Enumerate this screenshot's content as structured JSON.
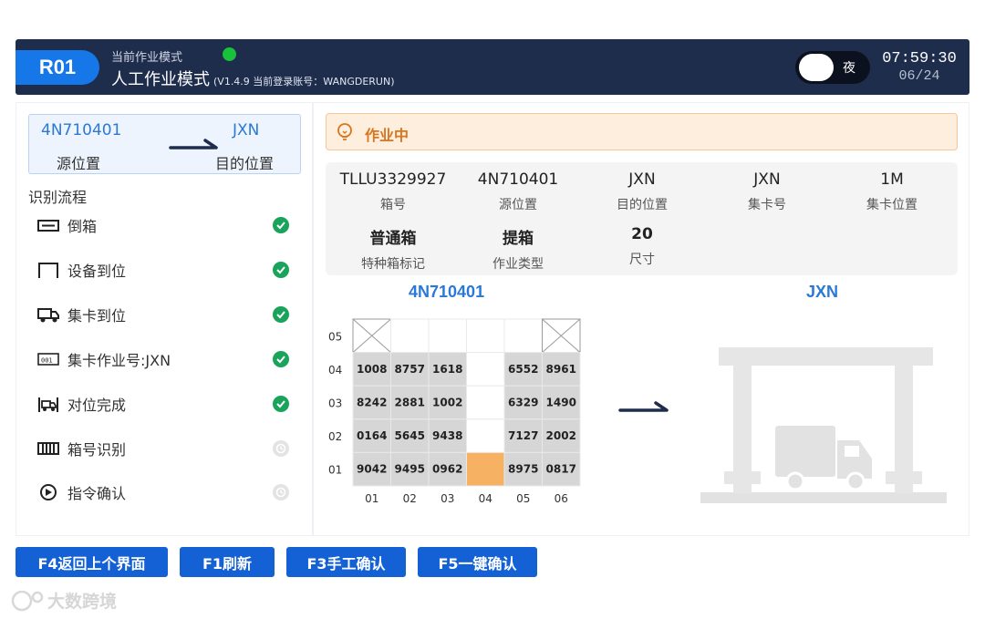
{
  "header": {
    "badge": "R01",
    "mode_caption": "当前作业模式",
    "mode_title": "人工作业模式",
    "version_info": "(V1.4.9 当前登录账号：WANGDERUN)",
    "night_toggle_label": "夜",
    "time": "07:59:30",
    "date": "06/24",
    "status_color": "#18c23a"
  },
  "route": {
    "source_code": "4N710401",
    "source_label": "源位置",
    "dest_code": "JXN",
    "dest_label": "目的位置"
  },
  "flow": {
    "title": "识别流程",
    "steps": [
      {
        "label": "倒箱",
        "icon": "container-icon",
        "status": "done"
      },
      {
        "label": "设备到位",
        "icon": "crane-frame-icon",
        "status": "done"
      },
      {
        "label": "集卡到位",
        "icon": "truck-icon",
        "status": "done"
      },
      {
        "label": "集卡作业号:JXN",
        "icon": "id-tag-icon",
        "status": "done"
      },
      {
        "label": "对位完成",
        "icon": "truck-align-icon",
        "status": "done"
      },
      {
        "label": "箱号识别",
        "icon": "barcode-icon",
        "status": "pending"
      },
      {
        "label": "指令确认",
        "icon": "play-circle-icon",
        "status": "pending"
      }
    ]
  },
  "alert": {
    "text": "作业中",
    "color": "#d9751e"
  },
  "job_info": {
    "row1": [
      {
        "value": "TLLU3329927",
        "label": "箱号"
      },
      {
        "value": "4N710401",
        "label": "源位置"
      },
      {
        "value": "JXN",
        "label": "目的位置"
      },
      {
        "value": "JXN",
        "label": "集卡号"
      },
      {
        "value": "1M",
        "label": "集卡位置"
      }
    ],
    "row2": [
      {
        "value": "普通箱",
        "label": "特种箱标记"
      },
      {
        "value": "提箱",
        "label": "作业类型"
      },
      {
        "value": "20",
        "label": "尺寸"
      }
    ]
  },
  "yard": {
    "source_title": "4N710401",
    "dest_title": "JXN",
    "row_labels": [
      "05",
      "04",
      "03",
      "02",
      "01"
    ],
    "col_labels": [
      "01",
      "02",
      "03",
      "04",
      "05",
      "06"
    ],
    "tiers": [
      [
        "X",
        "",
        "",
        "",
        "",
        "X"
      ],
      [
        "1008",
        "8757",
        "1618",
        "",
        "6552",
        "8961"
      ],
      [
        "8242",
        "2881",
        "1002",
        "",
        "6329",
        "1490"
      ],
      [
        "0164",
        "5645",
        "9438",
        "",
        "7127",
        "2002"
      ],
      [
        "9042",
        "9495",
        "0962",
        "*",
        "8975",
        "0817"
      ]
    ],
    "highlight_color": "#f7b163"
  },
  "buttons": [
    {
      "label": "F4返回上个界面"
    },
    {
      "label": "F1刷新"
    },
    {
      "label": "F3手工确认"
    },
    {
      "label": "F5一键确认"
    }
  ],
  "watermark": "大数跨境"
}
